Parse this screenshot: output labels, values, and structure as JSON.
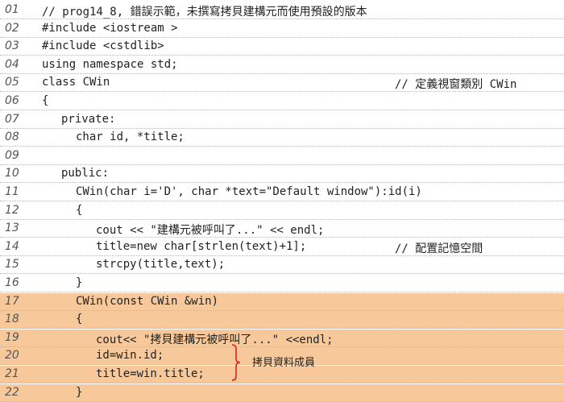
{
  "lines": [
    {
      "num": "01",
      "code": "// prog14_8, 錯誤示範，未撰寫拷貝建構元而使用預設的版本",
      "comment": ""
    },
    {
      "num": "02",
      "code": "#include <iostream >",
      "comment": ""
    },
    {
      "num": "03",
      "code": "#include <cstdlib>",
      "comment": ""
    },
    {
      "num": "04",
      "code": "using namespace std;",
      "comment": ""
    },
    {
      "num": "05",
      "code": "class CWin",
      "comment": "// 定義視窗類別 CWin"
    },
    {
      "num": "06",
      "code": "{",
      "comment": ""
    },
    {
      "num": "07",
      "code": "private:",
      "comment": ""
    },
    {
      "num": "08",
      "code": "char id, *title;",
      "comment": ""
    },
    {
      "num": "09",
      "code": "",
      "comment": ""
    },
    {
      "num": "10",
      "code": "public:",
      "comment": ""
    },
    {
      "num": "11",
      "code": "CWin(char i='D', char *text=\"Default window\"):id(i)",
      "comment": ""
    },
    {
      "num": "12",
      "code": "{",
      "comment": ""
    },
    {
      "num": "13",
      "code": "cout << \"建構元被呼叫了...\" << endl;",
      "comment": ""
    },
    {
      "num": "14",
      "code": "title=new char[strlen(text)+1];",
      "comment": "// 配置記憶空間"
    },
    {
      "num": "15",
      "code": "strcpy(title,text);",
      "comment": ""
    },
    {
      "num": "16",
      "code": "}",
      "comment": ""
    },
    {
      "num": "17",
      "code": "CWin(const CWin &win)",
      "comment": ""
    },
    {
      "num": "18",
      "code": "{",
      "comment": ""
    },
    {
      "num": "19",
      "code": "cout<< \"拷貝建構元被呼叫了...\" <<endl;",
      "comment": ""
    },
    {
      "num": "20",
      "code": "id=win.id;",
      "comment": ""
    },
    {
      "num": "21",
      "code": "title=win.title;",
      "comment": ""
    },
    {
      "num": "22",
      "code": "}",
      "comment": ""
    }
  ],
  "annotation": "拷貝資料成員",
  "colors": {
    "highlight": "#f7c99a",
    "brace": "#e0201b"
  }
}
